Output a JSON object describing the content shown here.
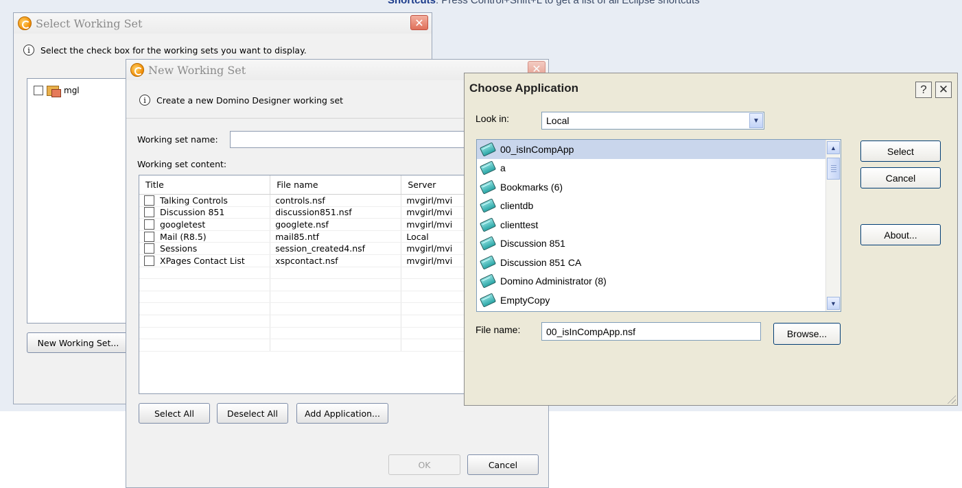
{
  "background": {
    "hint_bold": "Shortcuts",
    "hint_text": ": Press Control+Shift+L to get a list of all Eclipse shortcuts"
  },
  "select_working_set": {
    "title": "Select Working Set",
    "info": "Select the check box for the working sets you want to display.",
    "items": [
      {
        "label": "mgl",
        "checked": false
      }
    ],
    "new_button": "New Working Set..."
  },
  "new_working_set": {
    "title": "New Working Set",
    "info": "Create a new Domino Designer working set",
    "name_label": "Working set name:",
    "name_value": "",
    "content_label": "Working set content:",
    "columns": [
      "Title",
      "File name",
      "Server"
    ],
    "rows": [
      {
        "title": "Talking Controls",
        "file": "controls.nsf",
        "server": "mvgirl/mvi",
        "checked": false
      },
      {
        "title": "Discussion 851",
        "file": "discussion851.nsf",
        "server": "mvgirl/mvi",
        "checked": false
      },
      {
        "title": "googletest",
        "file": "googlete.nsf",
        "server": "mvgirl/mvi",
        "checked": false
      },
      {
        "title": "Mail (R8.5)",
        "file": "mail85.ntf",
        "server": "Local",
        "checked": false
      },
      {
        "title": "Sessions",
        "file": "session_created4.nsf",
        "server": "mvgirl/mvi",
        "checked": false
      },
      {
        "title": "XPages Contact List",
        "file": "xspcontact.nsf",
        "server": "mvgirl/mvi",
        "checked": false
      }
    ],
    "select_all": "Select All",
    "deselect_all": "Deselect All",
    "add_application": "Add Application...",
    "ok": "OK",
    "cancel": "Cancel"
  },
  "choose_application": {
    "title": "Choose Application",
    "help": "?",
    "close": "✕",
    "look_in_label": "Look in:",
    "look_in_value": "Local",
    "applications": [
      "00_isInCompApp",
      "a",
      "Bookmarks (6)",
      "clientdb",
      "clienttest",
      "Discussion 851",
      "Discussion 851 CA",
      "Domino Administrator (8)",
      "EmptyCopy"
    ],
    "selected_index": 0,
    "select": "Select",
    "cancel": "Cancel",
    "about": "About...",
    "file_name_label": "File name:",
    "file_name_value": "00_isInCompApp.nsf",
    "browse": "Browse..."
  }
}
